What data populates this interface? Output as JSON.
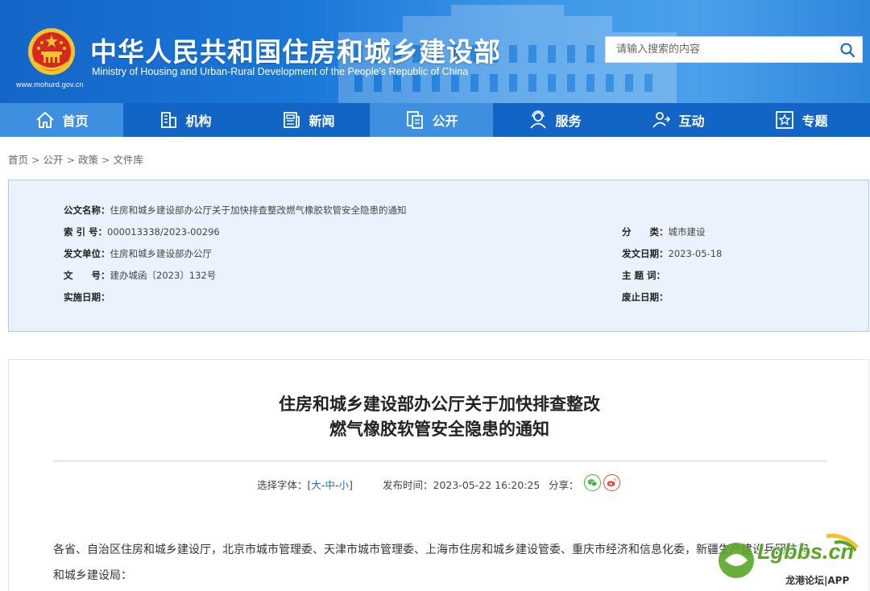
{
  "header": {
    "site_url": "www.mohurd.gov.cn",
    "title": "中华人民共和国住房和城乡建设部",
    "subtitle": "Ministry of Housing and Urban-Rural Development of the People's Republic of China",
    "search_placeholder": "请输入搜索的内容",
    "search_icon": "search-icon"
  },
  "nav": {
    "items": [
      {
        "label": "首页",
        "icon": "home-icon",
        "active": true
      },
      {
        "label": "机构",
        "icon": "building-icon",
        "active": false
      },
      {
        "label": "新闻",
        "icon": "news-icon",
        "active": false
      },
      {
        "label": "公开",
        "icon": "document-icon",
        "active": true
      },
      {
        "label": "服务",
        "icon": "service-icon",
        "active": false
      },
      {
        "label": "互动",
        "icon": "interact-icon",
        "active": false
      },
      {
        "label": "专题",
        "icon": "star-icon",
        "active": false
      }
    ]
  },
  "breadcrumb": {
    "items": [
      "首页",
      "公开",
      "政策",
      "文件库"
    ],
    "separator": ">"
  },
  "info": {
    "doc_name_label": "公文名称：",
    "doc_name_value": "住房和城乡建设部办公厅关于加快排查整改燃气橡胶软管安全隐患的通知",
    "index_label": "索 引 号：",
    "index_value": "000013338/2023-00296",
    "category_label": "分　　类：",
    "category_value": "城市建设",
    "issuer_label": "发文单位：",
    "issuer_value": "住房和城乡建设部办公厅",
    "issue_date_label": "发文日期：",
    "issue_date_value": "2023-05-18",
    "doc_no_label": "文　　号：",
    "doc_no_value": "建办城函〔2023〕132号",
    "keywords_label": "主 题 词：",
    "keywords_value": "",
    "effective_label": "实施日期：",
    "effective_value": "",
    "expiry_label": "废止日期：",
    "expiry_value": ""
  },
  "article": {
    "title_line1": "住房和城乡建设部办公厅关于加快排查整改",
    "title_line2": "燃气橡胶软管安全隐患的通知",
    "font_label": "选择字体：[",
    "font_large": "大",
    "font_medium": "中",
    "font_small": "小",
    "font_dash": "-",
    "font_close": "]",
    "pubtime_label": "发布时间：",
    "pubtime_value": "2023-05-22 16:20:25",
    "share_label": "分享：",
    "body_line1": "各省、自治区住房和城乡建设厅，北京市城市管理委、天津市城市管理委、上海市住房和城乡建设管委、重庆市经济和信息化委，新疆生产建设兵团住房",
    "body_line2": "和城乡建设局："
  },
  "watermark": {
    "brand": "Lgbbs.cn",
    "caption": "龙港论坛|APP"
  },
  "colors": {
    "header_blue": "#1565c8",
    "nav_blue": "#1265c4",
    "nav_active": "#3f8fe0",
    "info_bg": "#eaf3fd",
    "link_blue": "#1f6fd0"
  }
}
